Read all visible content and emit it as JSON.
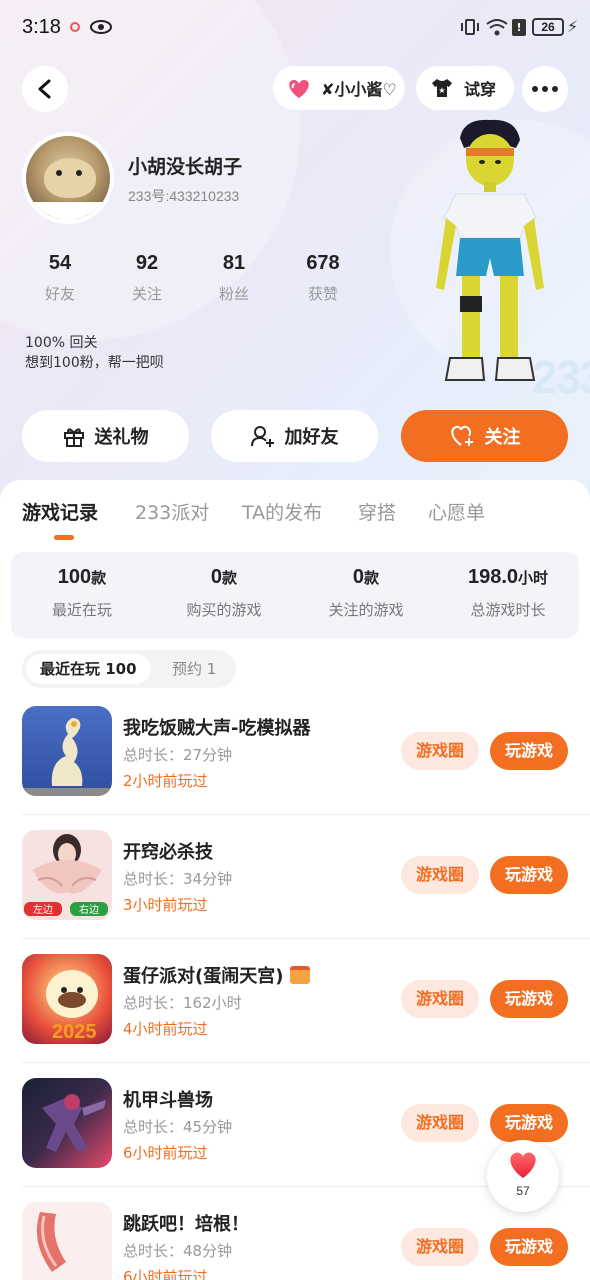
{
  "status_bar": {
    "time": "3:18",
    "battery": "26"
  },
  "top_bar": {
    "couple_label": "✘小小酱♡",
    "try_on_label": "试穿"
  },
  "profile": {
    "name": "小胡没长胡子",
    "uid": "233号:433210233",
    "stats": [
      {
        "value": "54",
        "label": "好友"
      },
      {
        "value": "92",
        "label": "关注"
      },
      {
        "value": "81",
        "label": "粉丝"
      },
      {
        "value": "678",
        "label": "获赞"
      }
    ],
    "bio_line1": "100% 回关",
    "bio_line2": "想到100粉，帮一把呗",
    "figure_badge": "233"
  },
  "actions": {
    "gift": "送礼物",
    "add_friend": "加好友",
    "follow": "关注"
  },
  "tabs": [
    "游戏记录",
    "233派对",
    "TA的发布",
    "穿搭",
    "心愿单"
  ],
  "summary": [
    {
      "value": "100",
      "unit": "款",
      "label": "最近在玩"
    },
    {
      "value": "0",
      "unit": "款",
      "label": "购买的游戏"
    },
    {
      "value": "0",
      "unit": "款",
      "label": "关注的游戏"
    },
    {
      "value": "198.0",
      "unit": "小时",
      "label": "总游戏时长"
    }
  ],
  "subtabs": {
    "recent": "最近在玩 100",
    "reserve": "预约 1"
  },
  "games": [
    {
      "title": "我吃饭贼大声-吃模拟器",
      "duration": "总时长：27分钟",
      "last_played": "2小时前玩过"
    },
    {
      "title": "开窍必杀技",
      "duration": "总时长：34分钟",
      "last_played": "3小时前玩过"
    },
    {
      "title": "蛋仔派对(蛋闹天宫)",
      "duration": "总时长：162小时",
      "last_played": "4小时前玩过"
    },
    {
      "title": "机甲斗兽场",
      "duration": "总时长：45分钟",
      "last_played": "6小时前玩过"
    },
    {
      "title": "跳跃吧！培根！",
      "duration": "总时长：48分钟",
      "last_played": "6小时前玩过"
    }
  ],
  "game_buttons": {
    "circle": "游戏圈",
    "play": "玩游戏"
  },
  "game2_thumb_labels": {
    "left": "左边",
    "right": "右边"
  },
  "game3_thumb_year": "2025",
  "fab": {
    "count": "57"
  }
}
